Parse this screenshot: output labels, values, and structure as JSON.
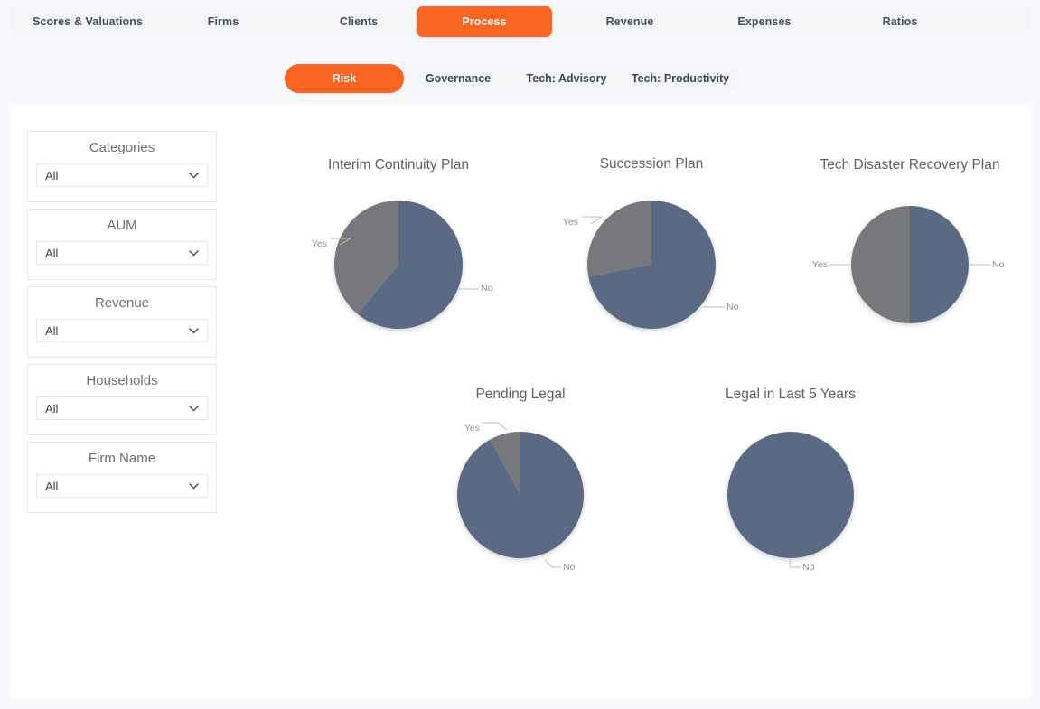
{
  "theme": {
    "accent": "#f96420",
    "page_bg": "#f7f9fc",
    "panel_bg": "#ffffff",
    "nav_bg": "#f4f5f7",
    "slice_no_color": "#5a6b85",
    "slice_yes_color": "#76787c",
    "title_color": "#5d6066",
    "label_color": "#8b8f96"
  },
  "topnav": {
    "tabs": [
      {
        "label": "Scores & Valuations",
        "active": false
      },
      {
        "label": "Firms",
        "active": false
      },
      {
        "label": "Clients",
        "active": false
      },
      {
        "label": "Process",
        "active": true
      },
      {
        "label": "Revenue",
        "active": false
      },
      {
        "label": "Expenses",
        "active": false
      },
      {
        "label": "Ratios",
        "active": false
      }
    ]
  },
  "subtabs": {
    "tabs": [
      {
        "label": "Risk",
        "active": true
      },
      {
        "label": "Governance",
        "active": false
      },
      {
        "label": "Tech: Advisory",
        "active": false
      },
      {
        "label": "Tech: Productivity",
        "active": false
      }
    ]
  },
  "filters": {
    "items": [
      {
        "title": "Categories",
        "value": "All",
        "icon": "chevron-down-icon"
      },
      {
        "title": "AUM",
        "value": "All",
        "icon": "chevron-down-icon"
      },
      {
        "title": "Revenue",
        "value": "All",
        "icon": "chevron-down-icon"
      },
      {
        "title": "Households",
        "value": "All",
        "icon": "chevron-down-icon"
      },
      {
        "title": "Firm Name",
        "value": "All",
        "icon": "chevron-down-icon"
      }
    ]
  },
  "chart_data": [
    {
      "type": "pie",
      "title": "Interim Continuity Plan",
      "categories": [
        "No",
        "Yes"
      ],
      "values": [
        61,
        39
      ],
      "colors": [
        "#5a6b85",
        "#76787c"
      ],
      "labels": [
        "No",
        "Yes"
      ],
      "legend": "none",
      "start_angle": 0
    },
    {
      "type": "pie",
      "title": "Succession Plan",
      "categories": [
        "No",
        "Yes"
      ],
      "values": [
        72,
        28
      ],
      "colors": [
        "#5a6b85",
        "#76787c"
      ],
      "labels": [
        "No",
        "Yes"
      ],
      "legend": "none",
      "start_angle": 0
    },
    {
      "type": "pie",
      "title": "Tech Disaster Recovery Plan",
      "categories": [
        "No",
        "Yes"
      ],
      "values": [
        50,
        50
      ],
      "colors": [
        "#5a6b85",
        "#76787c"
      ],
      "labels": [
        "No",
        "Yes"
      ],
      "legend": "none",
      "start_angle": 0
    },
    {
      "type": "pie",
      "title": "Pending Legal",
      "categories": [
        "No",
        "Yes"
      ],
      "values": [
        92,
        8
      ],
      "colors": [
        "#5a6b85",
        "#76787c"
      ],
      "labels": [
        "No",
        "Yes"
      ],
      "legend": "none",
      "start_angle": 0
    },
    {
      "type": "pie",
      "title": "Legal in Last 5 Years",
      "categories": [
        "No"
      ],
      "values": [
        100
      ],
      "colors": [
        "#5a6b85"
      ],
      "labels": [
        "No"
      ],
      "legend": "none",
      "start_angle": 0
    }
  ]
}
